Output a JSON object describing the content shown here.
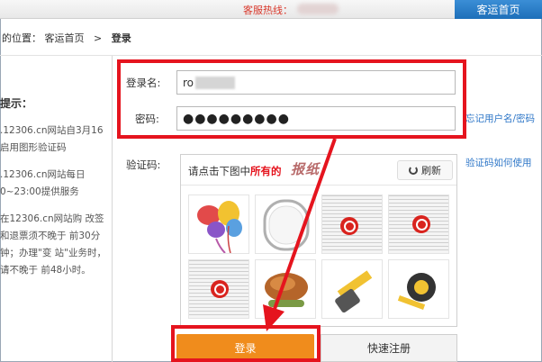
{
  "header": {
    "hotline_label": "客服热线：",
    "nav_button": "客运首页"
  },
  "breadcrumb": {
    "prefix": "的位置：",
    "home": "客运首页",
    "separator": ">",
    "current": "登录"
  },
  "tips": {
    "title": "提示：",
    "items": [
      ".12306.cn网站自3月16 启用图形验证码",
      ".12306.cn网站每日 0~23:00提供服务",
      "在12306.cn网站购 改签和退票须不晚于 前30分钟；办理\"变 站\"业务时，请不晚于 前48小时。"
    ]
  },
  "form": {
    "username_label": "登录名:",
    "username_value": "ro",
    "password_label": "密码:",
    "password_value": "●●●●●●●●●",
    "captcha_label": "验证码:",
    "forgot_link": "忘记用户名/密码",
    "captcha_help_link": "验证码如何使用"
  },
  "captcha": {
    "prompt_prefix": "请点击下图中",
    "prompt_highlight": "所有的",
    "target_word": "报纸",
    "refresh_label": "刷新",
    "tiles": [
      "balloons",
      "blank-frame",
      "newspaper-stamp",
      "newspaper-stamp",
      "newspaper-stamp",
      "roast-duck",
      "tape-measure",
      "tape-measure"
    ]
  },
  "buttons": {
    "login": "登录",
    "register": "快速注册"
  },
  "colors": {
    "highlight_red": "#e5141e",
    "login_orange": "#f08c1c",
    "nav_blue": "#1d6fb9",
    "link_blue": "#2f77c8"
  }
}
